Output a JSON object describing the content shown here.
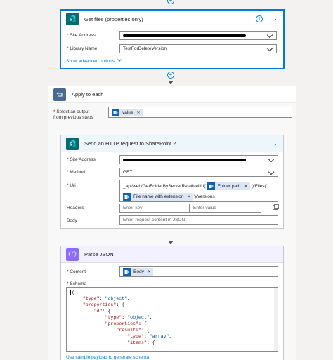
{
  "get_files": {
    "title": "Get files (properties only)",
    "site_address_label": "Site Address",
    "library_name_label": "Library Name",
    "library_name_value": "TestForDeleteVersion",
    "advanced_link": "Show advanced options"
  },
  "apply_each": {
    "title": "Apply to each",
    "select_label_line1": "Select an output",
    "select_label_line2": "from previous steps",
    "token": "value"
  },
  "http_request": {
    "title": "Send an HTTP request to SharePoint 2",
    "site_address_label": "Site Address",
    "method_label": "Method",
    "method_value": "GET",
    "uri_label": "Uri",
    "uri_prefix": "_api/web/GetFolderByServerRelativeUrl('",
    "token_folder": "Folder path",
    "uri_mid": "')/Files('",
    "token_file": "File name with extension",
    "uri_suffix": "')/Versions",
    "headers_label": "Headers",
    "header_key_placeholder": "Enter key",
    "header_value_placeholder": "Enter value",
    "body_label": "Body",
    "body_placeholder": "Enter request content in JSON"
  },
  "parse_json": {
    "title": "Parse JSON",
    "content_label": "Content",
    "token_body": "Body",
    "schema_label": "Schema",
    "sample_link": "Use sample payload to generate schema",
    "schema_lines": [
      "{",
      "    \"type\": \"object\",",
      "    \"properties\": {",
      "        \"d\": {",
      "            \"type\": \"object\",",
      "            \"properties\": {",
      "                \"results\": {",
      "                    \"type\": \"array\",",
      "                    \"items\": {"
    ]
  },
  "colors": {
    "sharepoint": "#036c70",
    "loop": "#486991",
    "parse": "#8c6cff",
    "accent": "#0078d4"
  }
}
